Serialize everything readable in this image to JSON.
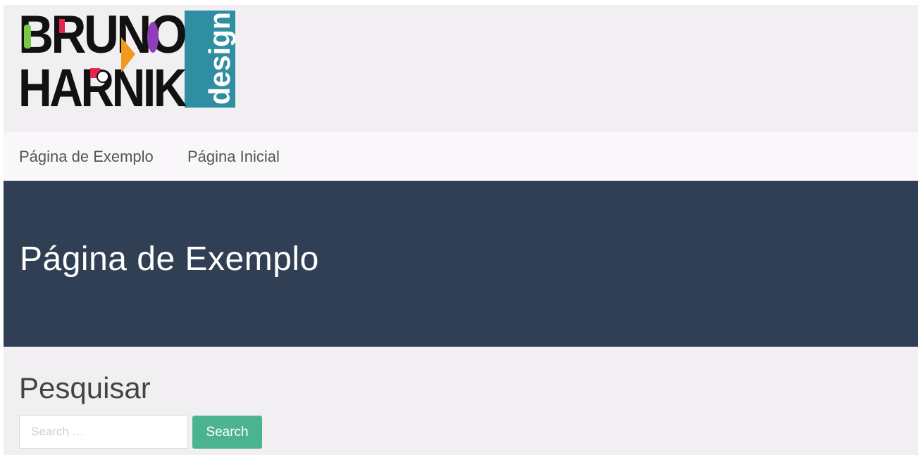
{
  "logo": {
    "name_line1": "BRUNO",
    "name_line2": "HARNIK",
    "tagline": "design"
  },
  "nav": {
    "items": [
      {
        "label": "Página de Exemplo"
      },
      {
        "label": "Página Inicial"
      }
    ]
  },
  "hero": {
    "title": "Página de Exemplo"
  },
  "sidebar": {
    "search_title": "Pesquisar",
    "search_placeholder": "Search …",
    "search_button": "Search"
  },
  "colors": {
    "page_background": "#f1eff1",
    "nav_background": "#f9f7f9",
    "hero_background": "#313f55",
    "search_button": "#4cb391",
    "logo_accent": "#2f8ea1"
  }
}
